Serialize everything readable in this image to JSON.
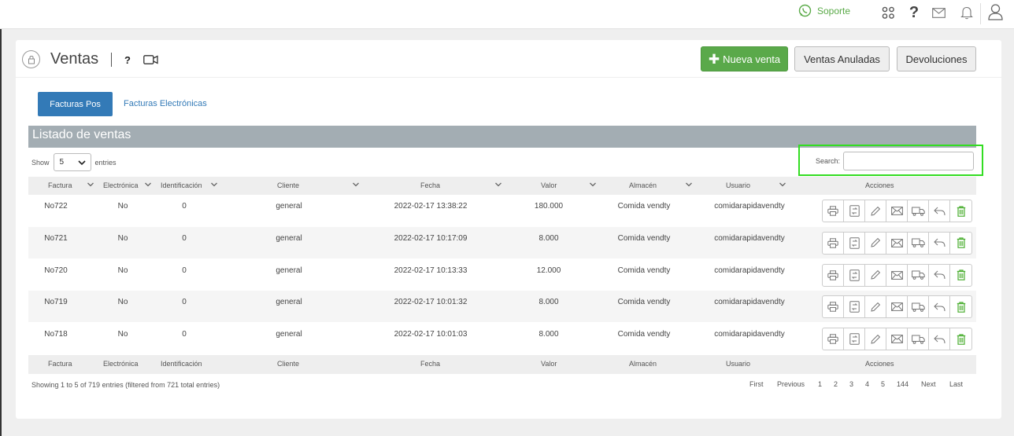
{
  "topbar": {
    "support_label": "Soporte",
    "icons": [
      "whatsapp-icon",
      "apps-grid-icon",
      "help-icon",
      "mail-icon",
      "bell-icon",
      "user-icon"
    ],
    "support_color": "#5aaa48"
  },
  "page": {
    "title": "Ventas",
    "help_label": "?",
    "new_sale_label": "Nueva venta",
    "voided_sales_label": "Ventas Anuladas",
    "returns_label": "Devoluciones"
  },
  "tabs": [
    {
      "label": "Facturas Pos",
      "active": true
    },
    {
      "label": "Facturas Electrónicas",
      "active": false
    }
  ],
  "list": {
    "title": "Listado de ventas",
    "show_label": "Show",
    "entries_label": "entries",
    "page_size": "5",
    "search_label": "Search:",
    "search_value": ""
  },
  "table": {
    "columns": [
      "Factura",
      "Electrónica",
      "Identificación",
      "Cliente",
      "Fecha",
      "Valor",
      "Almacén",
      "Usuario",
      "Acciones"
    ],
    "rows": [
      [
        "No722",
        "No",
        "0",
        "general",
        "2022-02-17 13:38:22",
        "180.000",
        "Comida vendty",
        "comidarapidavendty"
      ],
      [
        "No721",
        "No",
        "0",
        "general",
        "2022-02-17 10:17:09",
        "8.000",
        "Comida vendty",
        "comidarapidavendty"
      ],
      [
        "No720",
        "No",
        "0",
        "general",
        "2022-02-17 10:13:33",
        "12.000",
        "Comida vendty",
        "comidarapidavendty"
      ],
      [
        "No719",
        "No",
        "0",
        "general",
        "2022-02-17 10:01:32",
        "8.000",
        "Comida vendty",
        "comidarapidavendty"
      ],
      [
        "No718",
        "No",
        "0",
        "general",
        "2022-02-17 10:01:03",
        "8.000",
        "Comida vendty",
        "comidarapidavendty"
      ]
    ],
    "action_icons": [
      "print-icon",
      "exchange-icon",
      "edit-icon",
      "email-icon",
      "delivery-icon",
      "return-icon",
      "delete-icon"
    ]
  },
  "footer": {
    "summary": "Showing 1 to 5 of 719 entries (filtered from 721 total entries)",
    "pagination": [
      "First",
      "Previous",
      "1",
      "2",
      "3",
      "4",
      "5",
      "144",
      "Next",
      "Last"
    ]
  },
  "colors": {
    "primary": "#337ab7",
    "success": "#5aa94a",
    "header_gray": "#a3adb3",
    "highlight": "#33dd22"
  }
}
